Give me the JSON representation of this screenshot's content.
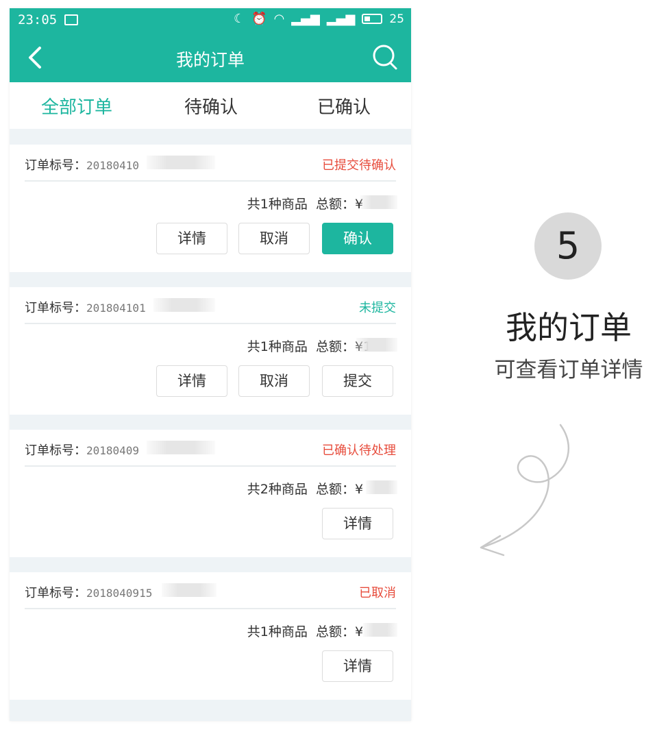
{
  "status_bar": {
    "time": "23:05",
    "battery": "25"
  },
  "header": {
    "title": "我的订单"
  },
  "tabs": [
    {
      "label": "全部订单",
      "active": true
    },
    {
      "label": "待确认",
      "active": false
    },
    {
      "label": "已确认",
      "active": false
    }
  ],
  "orders": [
    {
      "id_label": "订单标号：",
      "id_value": "20180410",
      "status": "已提交待确认",
      "status_color": "#e74c3c",
      "count_text": "共1种商品",
      "total_label": "总额：",
      "total_value": "¥",
      "buttons": [
        "详情",
        "取消",
        "确认"
      ]
    },
    {
      "id_label": "订单标号：",
      "id_value": "201804101",
      "status": "未提交",
      "status_color": "#1db69f",
      "count_text": "共1种商品",
      "total_label": "总额：",
      "total_value": "¥1",
      "buttons": [
        "详情",
        "取消",
        "提交"
      ]
    },
    {
      "id_label": "订单标号：",
      "id_value": "20180409",
      "status": "已确认待处理",
      "status_color": "#e74c3c",
      "count_text": "共2种商品",
      "total_label": "总额：",
      "total_value": "¥",
      "buttons": [
        "详情"
      ]
    },
    {
      "id_label": "订单标号：",
      "id_value": "2018040915",
      "status": "已取消",
      "status_color": "#e74c3c",
      "count_text": "共1种商品",
      "total_label": "总额：",
      "total_value": "¥",
      "buttons": [
        "详情"
      ]
    }
  ],
  "side": {
    "step": "5",
    "title": "我的订单",
    "subtitle": "可查看订单详情"
  },
  "colors": {
    "accent": "#1db69f",
    "alert": "#e74c3c"
  }
}
